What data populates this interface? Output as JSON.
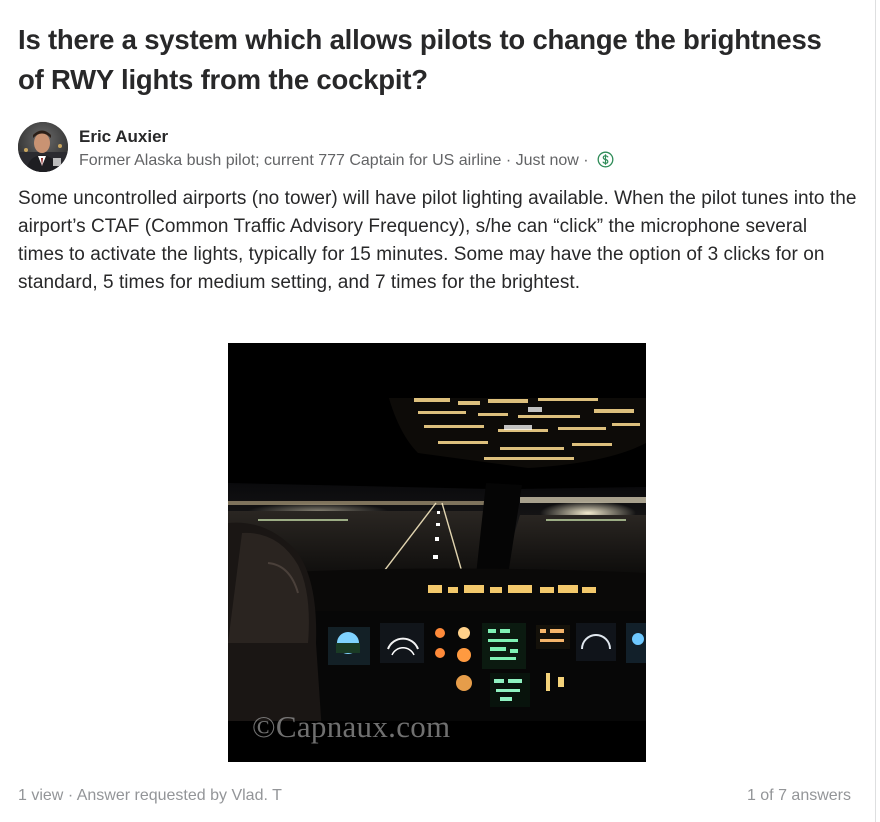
{
  "question": {
    "title": "Is there a system which allows pilots to change the brightness of RWY lights from the cockpit?"
  },
  "answer": {
    "author": {
      "name": "Eric Auxier",
      "credential": "Former Alaska bush pilot; current 777 Captain for US airline",
      "separator": "·",
      "time": "Just now",
      "monetization_icon": "dollar-circle-icon"
    },
    "body": "Some uncontrolled airports (no tower) will have pilot lighting available. When the pilot tunes into the airport’s CTAF (Common Traffic Advisory Frequency), s/he can “click” the microphone several times to activate the lights, typically for 15 minutes. Some may have the option of 3 clicks for on standard, 5 times for medium setting, and 7 times for the brightest.",
    "image": {
      "watermark": "©Capnaux.com"
    }
  },
  "footer": {
    "views": "1 view",
    "separator": "·",
    "requested": "Answer requested by Vlad. T",
    "position": "1 of 7 answers"
  },
  "colors": {
    "text": "#282829",
    "secondary": "#636466",
    "muted": "#939598",
    "money_green": "#2e8b57"
  }
}
